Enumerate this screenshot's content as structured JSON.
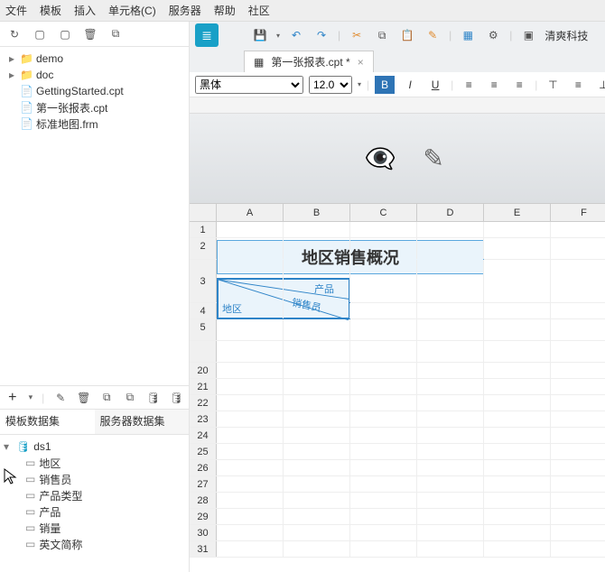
{
  "menu": [
    "文件",
    "模板",
    "插入",
    "单元格(C)",
    "服务器",
    "帮助",
    "社区"
  ],
  "file_tree": [
    {
      "tw": "▸",
      "icon": "📁",
      "cls": "fold",
      "label": "demo"
    },
    {
      "tw": "▸",
      "icon": "📁",
      "cls": "fold",
      "label": "doc"
    },
    {
      "tw": "",
      "icon": "📄",
      "cls": "file-cpt",
      "label": "GettingStarted.cpt"
    },
    {
      "tw": "",
      "icon": "📄",
      "cls": "file-cpt",
      "label": "第一张报表.cpt"
    },
    {
      "tw": "",
      "icon": "📄",
      "cls": "file-cpt",
      "label": "标准地图.frm"
    }
  ],
  "ds_tabs": [
    "模板数据集",
    "服务器数据集"
  ],
  "ds_active_tab": 0,
  "ds_root": "ds1",
  "ds_fields": [
    "地区",
    "销售员",
    "产品类型",
    "产品",
    "销量",
    "英文简称"
  ],
  "open_tab": "第一张报表.cpt *",
  "font_name": "黑体",
  "font_size": "12.0",
  "columns": [
    "A",
    "B",
    "C",
    "D",
    "E",
    "F"
  ],
  "rows": [
    "1",
    "2",
    "3",
    "4",
    "5",
    "",
    "20",
    "21",
    "22",
    "23",
    "24",
    "25",
    "26",
    "27",
    "28",
    "29",
    "30",
    "31"
  ],
  "title_cell": "地区销售概况",
  "diag_labels": {
    "top": "产品",
    "mid": "销售员",
    "bot": "地区"
  },
  "brand": "清爽科技",
  "icons": {
    "refresh": "↻",
    "new": "▢",
    "plus": "+",
    "edit": "✎",
    "delete": "🗑",
    "copy1": "⧉",
    "copy2": "⧉",
    "db1": "🛢",
    "db2": "🛢",
    "save": "💾",
    "undo": "↶",
    "redo": "↷",
    "cut": "✂",
    "copy": "⧉",
    "paste": "📋",
    "brush": "✎",
    "preview": "▦",
    "settings": "⚙",
    "logo": "≣",
    "eye_off": "👁",
    "pencil": "✎",
    "bold": "B",
    "italic": "I",
    "underline": "U"
  }
}
